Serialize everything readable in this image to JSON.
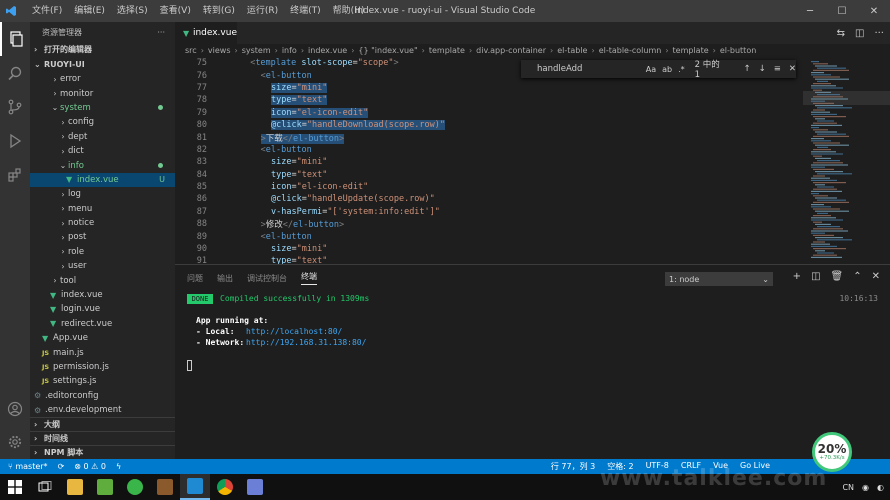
{
  "titlebar": {
    "menu": [
      "文件(F)",
      "编辑(E)",
      "选择(S)",
      "查看(V)",
      "转到(G)",
      "运行(R)",
      "终端(T)",
      "帮助(H)"
    ],
    "title": "index.vue - ruoyi-ui - Visual Studio Code"
  },
  "sidebar": {
    "header": "资源管理器",
    "open_editors": "打开的编辑器",
    "project": "RUOYI-UI",
    "tree": [
      {
        "label": "error",
        "kind": "folder",
        "depth": 2
      },
      {
        "label": "monitor",
        "kind": "folder",
        "depth": 2
      },
      {
        "label": "system",
        "kind": "folder-open",
        "depth": 2,
        "modified": true
      },
      {
        "label": "config",
        "kind": "folder",
        "depth": 3
      },
      {
        "label": "dept",
        "kind": "folder",
        "depth": 3
      },
      {
        "label": "dict",
        "kind": "folder",
        "depth": 3
      },
      {
        "label": "info",
        "kind": "folder-open",
        "depth": 3,
        "modified": true
      },
      {
        "label": "index.vue",
        "kind": "vue",
        "depth": 4,
        "badge": "U",
        "selected": true
      },
      {
        "label": "log",
        "kind": "folder",
        "depth": 3
      },
      {
        "label": "menu",
        "kind": "folder",
        "depth": 3
      },
      {
        "label": "notice",
        "kind": "folder",
        "depth": 3
      },
      {
        "label": "post",
        "kind": "folder",
        "depth": 3
      },
      {
        "label": "role",
        "kind": "folder",
        "depth": 3
      },
      {
        "label": "user",
        "kind": "folder",
        "depth": 3
      },
      {
        "label": "tool",
        "kind": "folder",
        "depth": 2
      },
      {
        "label": "index.vue",
        "kind": "vue",
        "depth": 2
      },
      {
        "label": "login.vue",
        "kind": "vue",
        "depth": 2
      },
      {
        "label": "redirect.vue",
        "kind": "vue",
        "depth": 2
      },
      {
        "label": "App.vue",
        "kind": "vue",
        "depth": 1
      },
      {
        "label": "main.js",
        "kind": "js",
        "depth": 1
      },
      {
        "label": "permission.js",
        "kind": "js",
        "depth": 1
      },
      {
        "label": "settings.js",
        "kind": "js",
        "depth": 1
      },
      {
        "label": ".editorconfig",
        "kind": "cfg",
        "depth": 0
      },
      {
        "label": ".env.development",
        "kind": "cfg",
        "depth": 0
      }
    ],
    "outline": "大纲",
    "timeline": "时间线",
    "npm": "NPM 脚本"
  },
  "editor": {
    "tab": "index.vue",
    "breadcrumb": [
      "src",
      "views",
      "system",
      "info",
      "index.vue",
      "{} \"index.vue\"",
      "template",
      "div.app-container",
      "el-table",
      "el-table-column",
      "template",
      "el-button"
    ],
    "find": {
      "query": "handleAdd",
      "opts": [
        "Aa",
        "ab",
        ".*"
      ],
      "result": "2 中的 1"
    },
    "lines": [
      {
        "n": "75",
        "indent": 6,
        "parts": [
          [
            "tag",
            "<"
          ],
          [
            "tn",
            "template"
          ],
          [
            "an",
            " slot-scope"
          ],
          [
            "tx",
            "="
          ],
          [
            "av",
            "\"scope\""
          ],
          [
            "tag",
            ">"
          ]
        ]
      },
      {
        "n": "76",
        "indent": 8,
        "parts": [
          [
            "tag",
            "<"
          ],
          [
            "tn",
            "el-button"
          ]
        ]
      },
      {
        "n": "77",
        "indent": 10,
        "sel": true,
        "parts": [
          [
            "an",
            "size"
          ],
          [
            "tx",
            "="
          ],
          [
            "av",
            "\"mini\""
          ]
        ]
      },
      {
        "n": "78",
        "indent": 10,
        "sel": true,
        "parts": [
          [
            "an",
            "type"
          ],
          [
            "tx",
            "="
          ],
          [
            "av",
            "\"text\""
          ]
        ]
      },
      {
        "n": "79",
        "indent": 10,
        "sel": true,
        "parts": [
          [
            "an",
            "icon"
          ],
          [
            "tx",
            "="
          ],
          [
            "av",
            "\"el-icon-edit\""
          ]
        ]
      },
      {
        "n": "80",
        "indent": 10,
        "sel": true,
        "parts": [
          [
            "an",
            "@click"
          ],
          [
            "tx",
            "="
          ],
          [
            "av",
            "\"handleDownload(scope.row)\""
          ]
        ]
      },
      {
        "n": "81",
        "indent": 8,
        "sel": true,
        "parts": [
          [
            "tag",
            ">"
          ],
          [
            "tx",
            "下载"
          ],
          [
            "tag",
            "</"
          ],
          [
            "tn",
            "el-button"
          ],
          [
            "tag",
            ">"
          ]
        ]
      },
      {
        "n": "82",
        "indent": 8,
        "parts": [
          [
            "tag",
            "<"
          ],
          [
            "tn",
            "el-button"
          ]
        ]
      },
      {
        "n": "83",
        "indent": 10,
        "parts": [
          [
            "an",
            "size"
          ],
          [
            "tx",
            "="
          ],
          [
            "av",
            "\"mini\""
          ]
        ]
      },
      {
        "n": "84",
        "indent": 10,
        "parts": [
          [
            "an",
            "type"
          ],
          [
            "tx",
            "="
          ],
          [
            "av",
            "\"text\""
          ]
        ]
      },
      {
        "n": "85",
        "indent": 10,
        "parts": [
          [
            "an",
            "icon"
          ],
          [
            "tx",
            "="
          ],
          [
            "av",
            "\"el-icon-edit\""
          ]
        ]
      },
      {
        "n": "86",
        "indent": 10,
        "parts": [
          [
            "an",
            "@click"
          ],
          [
            "tx",
            "="
          ],
          [
            "av",
            "\"handleUpdate(scope.row)\""
          ]
        ]
      },
      {
        "n": "87",
        "indent": 10,
        "parts": [
          [
            "an",
            "v-hasPermi"
          ],
          [
            "tx",
            "="
          ],
          [
            "av",
            "\"['system:info:edit']\""
          ]
        ]
      },
      {
        "n": "88",
        "indent": 8,
        "parts": [
          [
            "tag",
            ">"
          ],
          [
            "tx",
            "修改"
          ],
          [
            "tag",
            "</"
          ],
          [
            "tn",
            "el-button"
          ],
          [
            "tag",
            ">"
          ]
        ]
      },
      {
        "n": "89",
        "indent": 8,
        "parts": [
          [
            "tag",
            "<"
          ],
          [
            "tn",
            "el-button"
          ]
        ]
      },
      {
        "n": "90",
        "indent": 10,
        "parts": [
          [
            "an",
            "size"
          ],
          [
            "tx",
            "="
          ],
          [
            "av",
            "\"mini\""
          ]
        ]
      },
      {
        "n": "91",
        "indent": 10,
        "parts": [
          [
            "an",
            "type"
          ],
          [
            "tx",
            "="
          ],
          [
            "av",
            "\"text\""
          ]
        ]
      }
    ]
  },
  "panel": {
    "tabs": [
      "问题",
      "输出",
      "调试控制台",
      "终端"
    ],
    "active_tab": "终端",
    "terminal_select": "1: node",
    "badge": "DONE",
    "compiled": "Compiled successfully in 1309ms",
    "time": "10:16:13",
    "running": "App running at:",
    "local_label": "- Local:",
    "local_url": "http://localhost:80/",
    "network_label": "- Network:",
    "network_url": "http://192.168.31.138:80/"
  },
  "statusbar": {
    "branch": "master*",
    "errors": "⊗ 0 ⚠ 0",
    "position": "行 77，列 3",
    "items": [
      "空格: 2",
      "UTF-8",
      "CRLF",
      "Vue",
      "Go Live"
    ]
  },
  "netmeter": {
    "percent": "20%",
    "speed": "+70.3K/s"
  },
  "tray": {
    "lang": "CN"
  },
  "watermark": "www.talklee.com",
  "colors": {
    "accent": "#007acc",
    "selection": "#264f78",
    "vue": "#41b883",
    "git_added": "#73c991"
  }
}
